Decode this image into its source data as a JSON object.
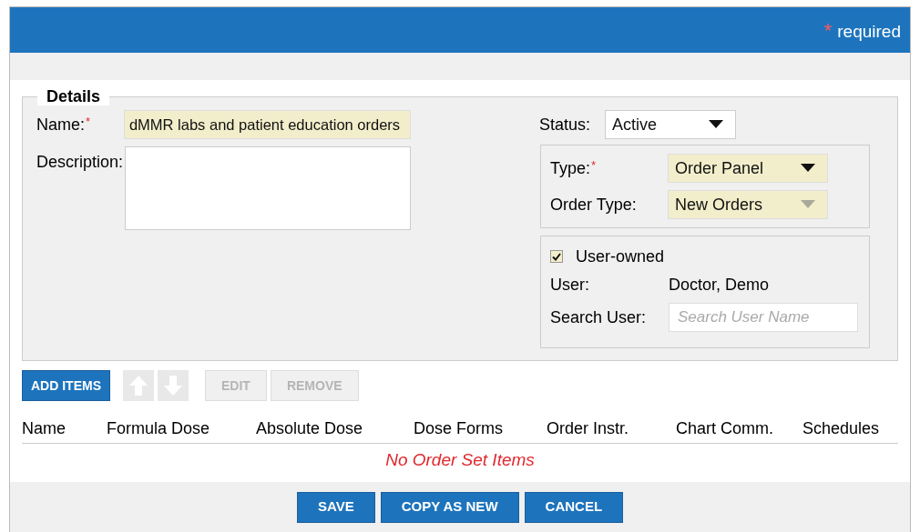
{
  "header": {
    "required_mark": "*",
    "required_note": "required"
  },
  "details": {
    "legend": "Details",
    "name": {
      "label": "Name:",
      "required_mark": "*",
      "value": "dMMR labs and patient education orders"
    },
    "description": {
      "label": "Description:"
    },
    "status": {
      "label": "Status:",
      "value": "Active",
      "disabled": false
    },
    "type": {
      "label": "Type:",
      "required_mark": "*",
      "value": "Order Panel",
      "disabled": false
    },
    "order_type": {
      "label": "Order Type:",
      "value": "New Orders",
      "disabled": true
    },
    "user_owned": {
      "label": "User-owned",
      "checked": true
    },
    "user": {
      "label": "User:",
      "value": "Doctor, Demo"
    },
    "search_user": {
      "label": "Search User:",
      "placeholder": "Search User Name"
    }
  },
  "toolbar": [
    {
      "kind": "text",
      "label": "ADD ITEMS",
      "disabled": false
    },
    {
      "kind": "up",
      "disabled": true
    },
    {
      "kind": "down",
      "disabled": true
    },
    {
      "kind": "text",
      "label": "EDIT",
      "disabled": true
    },
    {
      "kind": "text",
      "label": "REMOVE",
      "disabled": true
    }
  ],
  "table": {
    "columns": [
      "Name",
      "Formula Dose",
      "Absolute Dose",
      "Dose Forms",
      "Order Instr.",
      "Chart Comm.",
      "Schedules"
    ],
    "empty_message": "No Order Set Items"
  },
  "footer_buttons": [
    "SAVE",
    "COPY AS NEW",
    "CANCEL"
  ]
}
